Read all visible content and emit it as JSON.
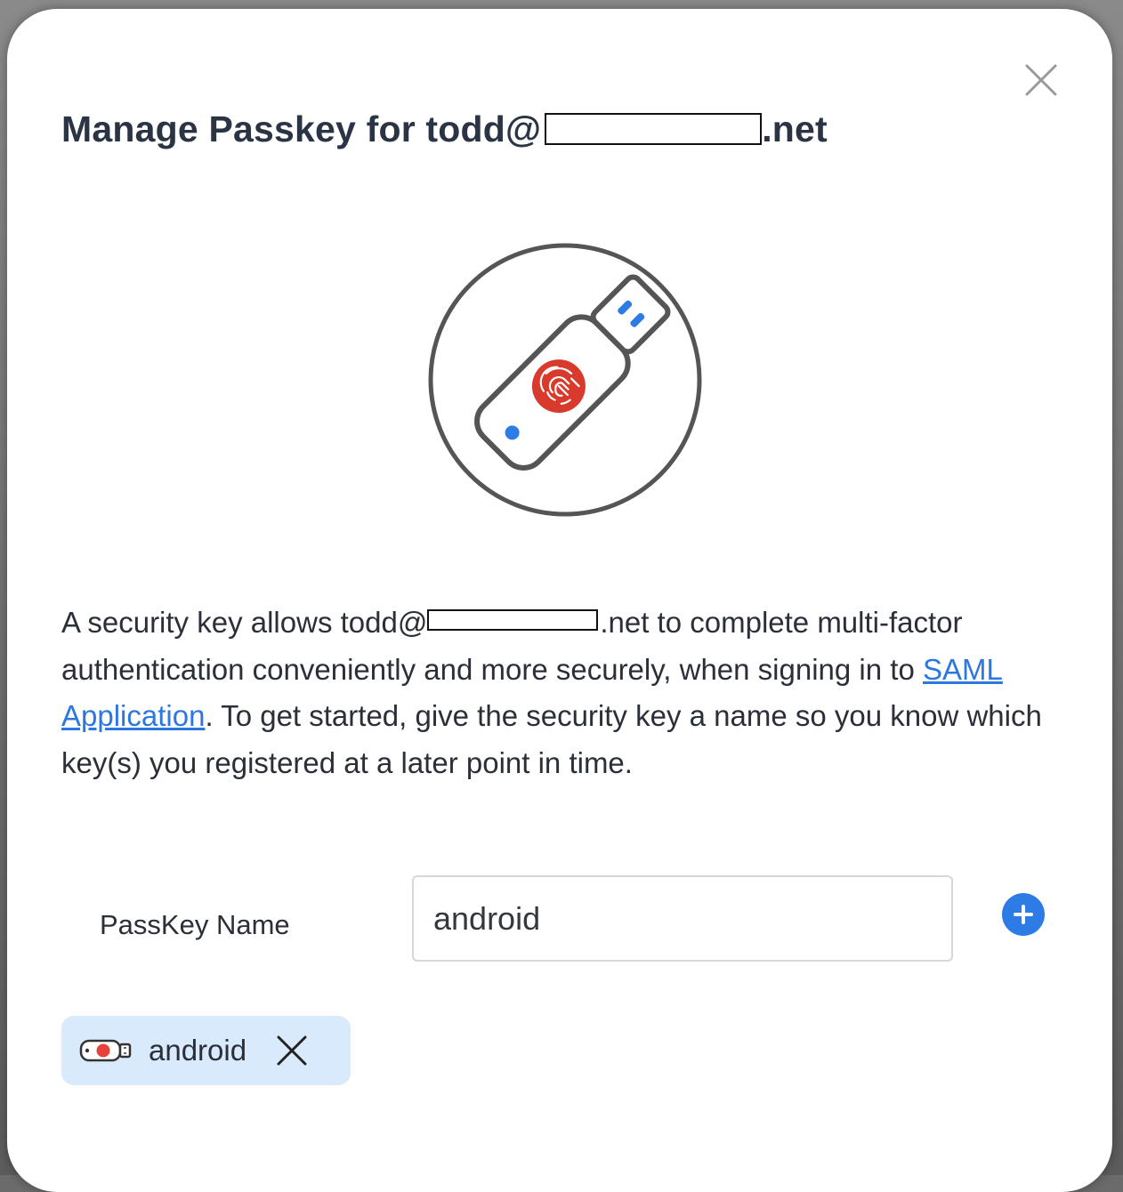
{
  "modal": {
    "title_prefix": "Manage Passkey for todd@",
    "title_suffix": ".net",
    "close_icon": "close-icon"
  },
  "illustration": {
    "icon": "security-key-fingerprint-icon",
    "colors": {
      "outline": "#555555",
      "fingerprint": "#d83a2c",
      "accent": "#2d7be5"
    }
  },
  "description": {
    "part1": "A security key allows todd@",
    "part2": ".net to complete multi-factor authentication conveniently and more securely, when signing in to ",
    "link": "SAML Application",
    "part3": ". To get started, give the security key a name so you know which key(s) you registered at a later point in time."
  },
  "form": {
    "label": "PassKey Name",
    "value": "android",
    "add_icon": "plus-circle-icon"
  },
  "passkeys": [
    {
      "name": "android",
      "icon": "usb-key-icon",
      "remove_icon": "close-icon"
    }
  ],
  "colors": {
    "accent": "#2d7be5",
    "chip_bg": "#d9eafd",
    "title": "#2b3445"
  }
}
